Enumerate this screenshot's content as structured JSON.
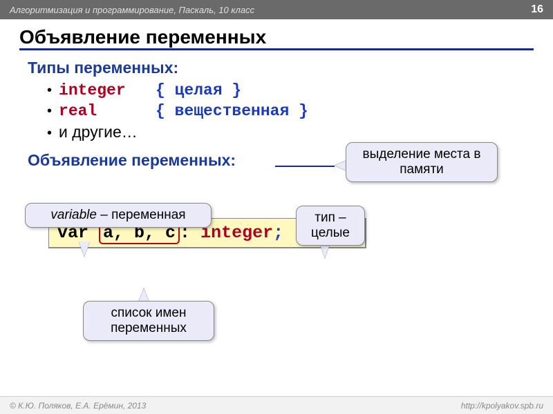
{
  "header": {
    "course": "Алгоритмизация и программирование, Паскаль, 10 класс",
    "page": "16"
  },
  "title": "Объявление переменных",
  "types_heading": "Типы переменных:",
  "bullets": {
    "integer_kw": "integer",
    "integer_comment": "{ целая }",
    "real_kw": "real",
    "real_comment": "{ вещественная }",
    "others": "и другие…"
  },
  "decl_heading": "Объявление переменных:",
  "callouts": {
    "memory": "выделение места в памяти",
    "variable_it": "variable",
    "variable_rest": " – переменная",
    "type": "тип – целые",
    "list": "список имен переменных"
  },
  "code": {
    "var": "var ",
    "names": "a, b, c",
    "colon": ": ",
    "integer": "integer",
    "semi": ";"
  },
  "footer": {
    "left": "© К.Ю. Поляков, Е.А. Ерёмин, 2013",
    "right": "http://kpolyakov.spb.ru"
  }
}
